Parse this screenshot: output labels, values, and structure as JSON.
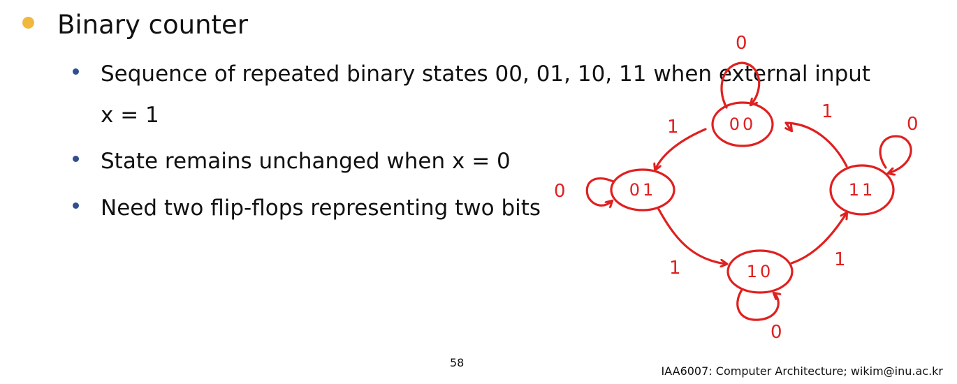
{
  "slide": {
    "heading": "Binary counter",
    "bullets": [
      "Sequence of repeated binary states 00, 01, 10, 11 when external input",
      "x = 1",
      "State remains unchanged when x = 0",
      "Need two flip-flops representing two bits"
    ]
  },
  "diagram": {
    "states": [
      "00",
      "01",
      "10",
      "11"
    ],
    "transitions": {
      "s00_to_s01": "1",
      "s01_to_s10": "1",
      "s10_to_s11": "1",
      "s11_to_s00": "1"
    },
    "self_loops": {
      "s00": "0",
      "s01": "0",
      "s10": "0",
      "s11": "0"
    },
    "ink_color": "#e02020"
  },
  "footer": {
    "page_number": "58",
    "course": "IAA6007: Computer Architecture; wikim@inu.ac.kr"
  }
}
